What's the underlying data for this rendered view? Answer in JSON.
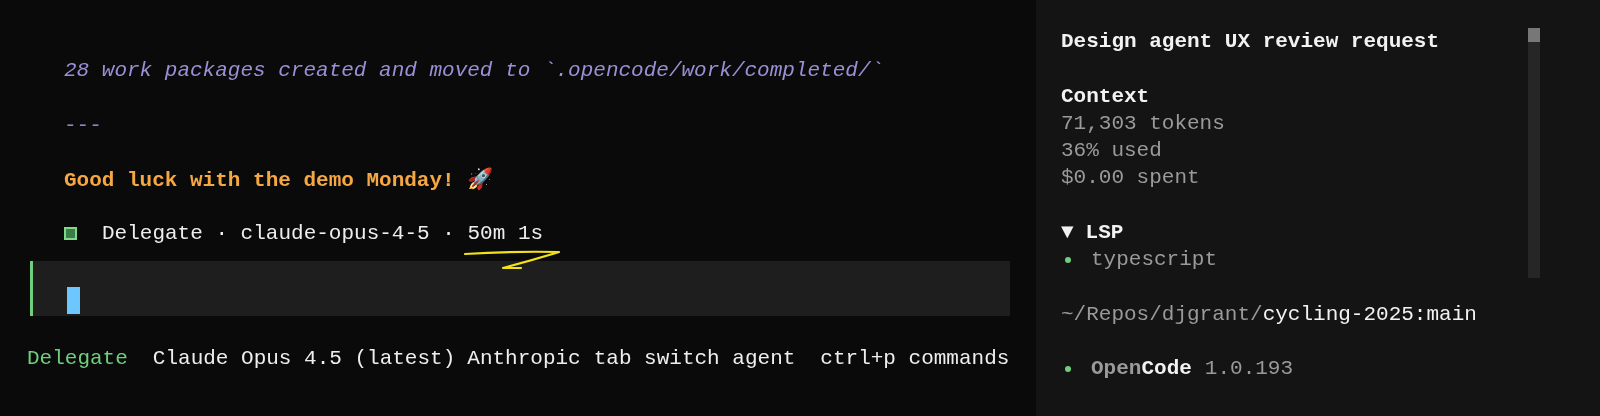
{
  "messages": [
    {
      "kind": "note",
      "text": "28 work packages created and moved to `.opencode/work/completed/`"
    },
    {
      "kind": "rule",
      "text": "---"
    },
    {
      "kind": "heading",
      "text": "Good luck with the demo Monday! 🚀"
    }
  ],
  "run": {
    "agent": "Delegate",
    "model": "claude-opus-4-5",
    "duration": "50m 1s",
    "separator": "·"
  },
  "prompt": {
    "focused": true
  },
  "status_bar": {
    "agent": "Delegate",
    "items": [
      "Claude Opus 4.5 (latest)",
      "Anthropic",
      "tab switch agent",
      "ctrl+p commands"
    ]
  },
  "sidebar": {
    "title": "Design agent UX review request",
    "context": {
      "heading": "Context",
      "lines": [
        "71,303 tokens",
        "36% used",
        "$0.00 spent"
      ]
    },
    "lsp": {
      "toggle": "▼",
      "heading": "LSP",
      "expanded": true,
      "servers": [
        {
          "name": "typescript",
          "color": "#6fcf7f"
        }
      ]
    },
    "path": {
      "prefix": "~/Repos/djgrant/",
      "project": "cycling-2025:main"
    },
    "app": {
      "name_dim": "Open",
      "name_bright": "Code",
      "version": "1.0.193",
      "color": "#6fcf7f"
    }
  }
}
